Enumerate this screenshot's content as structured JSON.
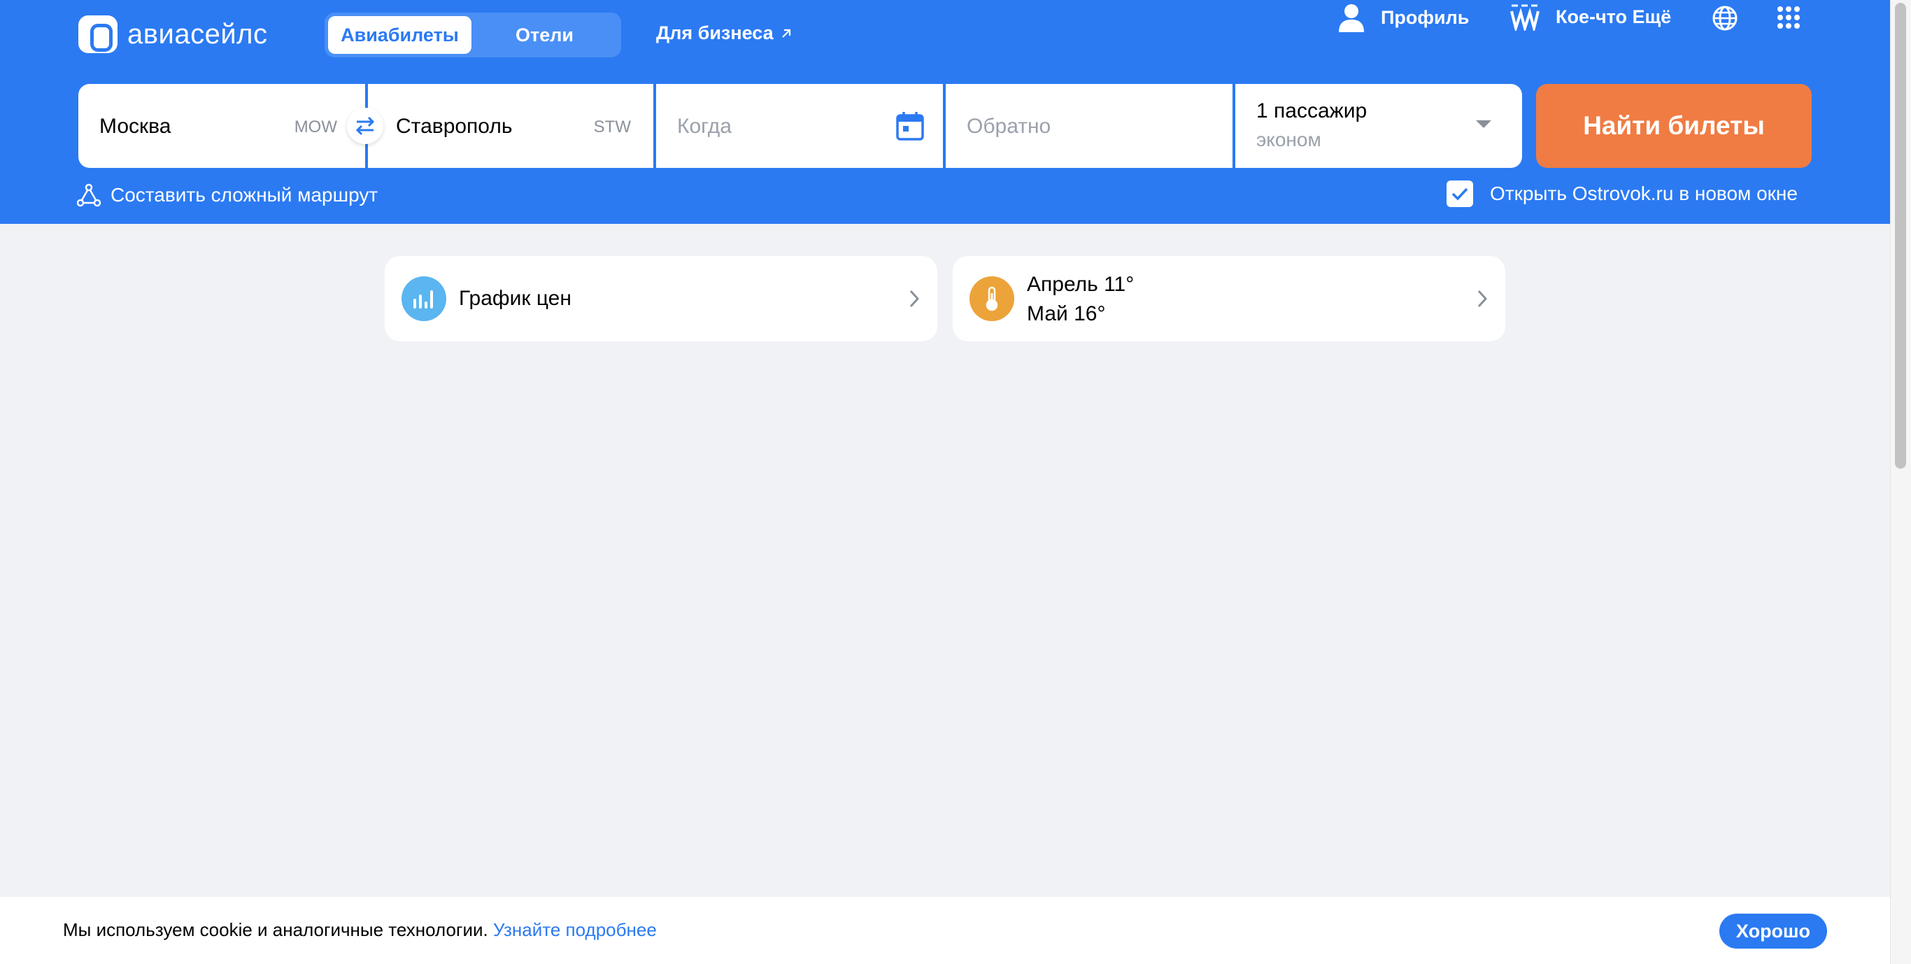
{
  "header": {
    "logo_text": "авиасейлс",
    "tabs": [
      {
        "label": "Авиабилеты",
        "active": true
      },
      {
        "label": "Отели",
        "active": false
      }
    ],
    "business_link": "Для бизнеса",
    "profile_label": "Профиль",
    "more_label": "Кое-что Ещё",
    "icons": [
      "profile-icon",
      "more-icon",
      "globe-icon",
      "apps-grid-icon"
    ]
  },
  "search": {
    "origin": {
      "city": "Москва",
      "code": "MOW"
    },
    "destination": {
      "city": "Ставрополь",
      "code": "STW"
    },
    "depart": {
      "placeholder": "Когда"
    },
    "return": {
      "placeholder": "Обратно"
    },
    "passengers": {
      "count_label": "1 пассажир",
      "class_label": "эконом"
    },
    "submit_label": "Найти билеты",
    "complex_route_label": "Составить сложный маршрут",
    "ostrovok_label": "Открыть Ostrovok.ru в новом окне",
    "ostrovok_checked": true
  },
  "cards": {
    "price_chart_label": "График цен",
    "weather_line1": "Апрель 11°",
    "weather_line2": "Май 16°"
  },
  "cookie": {
    "text": "Мы используем cookie и аналогичные технологии. ",
    "link": "Узнайте подробнее",
    "button": "Хорошо"
  },
  "colors": {
    "brand_blue": "#2b7af2",
    "accent_orange": "#f07c43",
    "page_bg": "#f0f2f5",
    "price_icon_bg": "#5ab5f0",
    "weather_icon_bg": "#eca339"
  }
}
